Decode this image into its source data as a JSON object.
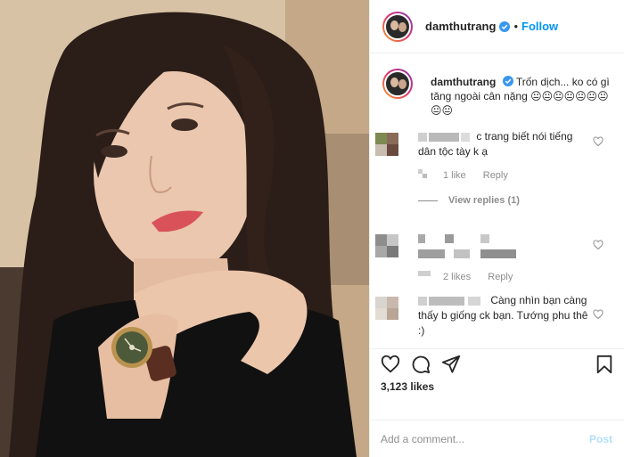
{
  "post": {
    "username": "damthutrang",
    "follow_label": "Follow",
    "dot": "•",
    "caption_text": "Trốn dịch... ko có gì tăng ngoài cân nặng 😐😐😐😐😐😐😐😐😐"
  },
  "comments": [
    {
      "text": "c trang biết nói tiếng dân tộc tày k ạ",
      "likes": "1 like",
      "reply_label": "Reply",
      "view_replies": "View replies (1)"
    },
    {
      "text": "",
      "likes": "2 likes",
      "reply_label": "Reply"
    },
    {
      "text": "Càng nhìn bạn càng thấy b giống ck bạn. Tướng phu thê :)",
      "likes": "",
      "reply_label": ""
    }
  ],
  "actions": {
    "icons": [
      "heart-icon",
      "comment-icon",
      "share-icon",
      "bookmark-icon"
    ],
    "like_count": "3,123 likes"
  },
  "add_comment": {
    "placeholder": "Add a comment...",
    "post_label": "Post"
  },
  "colors": {
    "link_blue": "#0095f6",
    "post_disabled": "#b2dffc",
    "muted": "#8e8e8e",
    "border": "#efefef"
  }
}
